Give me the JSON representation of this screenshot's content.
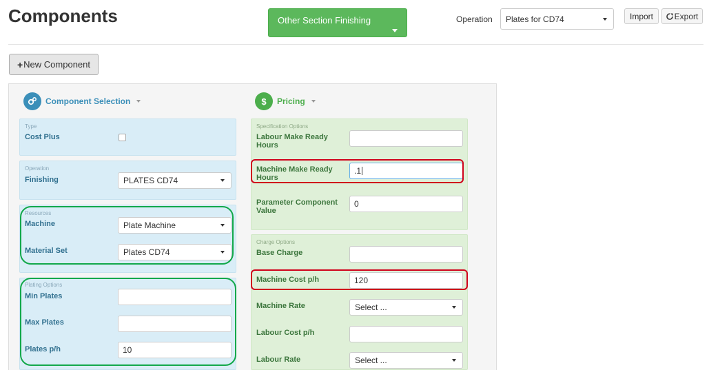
{
  "header": {
    "title": "Components",
    "section_button": "Other Section Finishing",
    "operation_label": "Operation",
    "operation_value": "Plates for CD74",
    "import_label": "Import",
    "export_label": "Export"
  },
  "toolbar": {
    "new_component_label": "New Component"
  },
  "component_selection": {
    "title": "Component Selection",
    "icon": "cogs-icon",
    "type_card": {
      "heading": "Type",
      "cost_plus_label": "Cost Plus",
      "cost_plus_checked": false
    },
    "operation_card": {
      "heading": "Operation",
      "finishing_label": "Finishing",
      "finishing_value": "PLATES CD74"
    },
    "resources_card": {
      "heading": "Resources",
      "machine_label": "Machine",
      "machine_value": "Plate Machine",
      "material_set_label": "Material Set",
      "material_set_value": "Plates CD74"
    },
    "plating_card": {
      "heading": "Plating Options",
      "min_plates_label": "Min Plates",
      "min_plates_value": "",
      "max_plates_label": "Max Plates",
      "max_plates_value": "",
      "plates_ph_label": "Plates p/h",
      "plates_ph_value": "10"
    }
  },
  "pricing": {
    "title": "Pricing",
    "icon": "dollar-icon",
    "spec_card": {
      "heading": "Specification Options",
      "labour_make_ready_label": "Labour Make Ready Hours",
      "labour_make_ready_value": "",
      "machine_make_ready_label": "Machine Make Ready Hours",
      "machine_make_ready_value": ".1",
      "parameter_component_label": "Parameter Component Value",
      "parameter_component_value": "0"
    },
    "charge_card": {
      "heading": "Charge Options",
      "base_charge_label": "Base Charge",
      "base_charge_value": "",
      "machine_cost_label": "Machine Cost p/h",
      "machine_cost_value": "120",
      "machine_rate_label": "Machine Rate",
      "machine_rate_value": "Select ...",
      "labour_cost_label": "Labour Cost p/h",
      "labour_cost_value": "",
      "labour_rate_label": "Labour Rate",
      "labour_rate_value": "Select ..."
    }
  },
  "colors": {
    "primary_green": "#5cb85c",
    "info_blue": "#31708f",
    "success_green": "#3c763d",
    "highlight_red": "#d0021b",
    "highlight_green": "#12a84a"
  }
}
